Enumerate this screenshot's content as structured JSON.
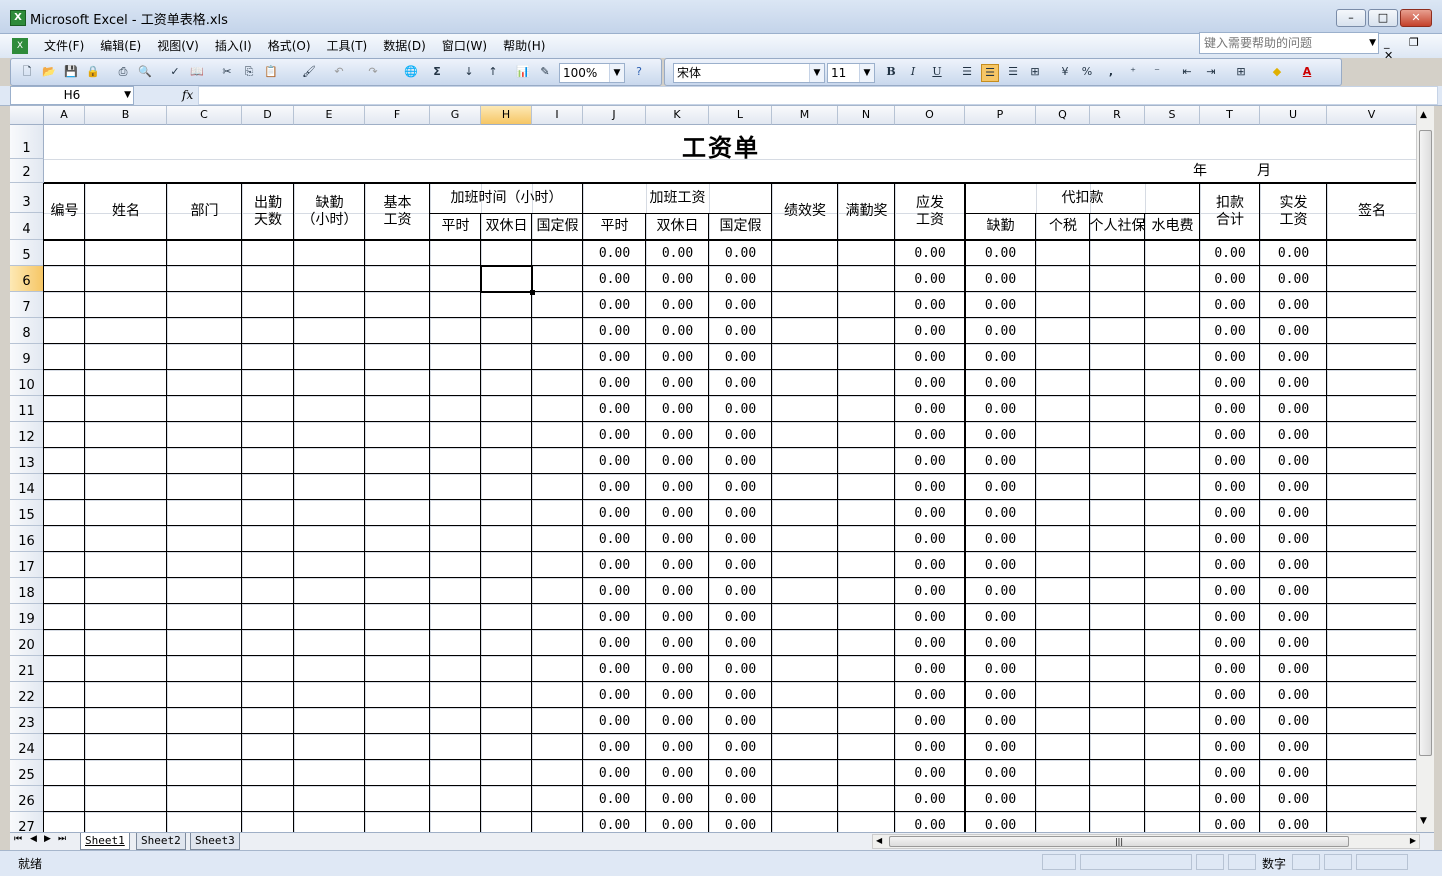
{
  "window": {
    "app_name": "Microsoft Excel",
    "separator": " - ",
    "file_name": "工资单表格.xls"
  },
  "menu": [
    "文件(F)",
    "编辑(E)",
    "视图(V)",
    "插入(I)",
    "格式(O)",
    "工具(T)",
    "数据(D)",
    "窗口(W)",
    "帮助(H)"
  ],
  "help_search": {
    "placeholder": "键入需要帮助的问题"
  },
  "toolbar": {
    "zoom": "100%",
    "font_name": "宋体",
    "font_size": "11",
    "bold": "B",
    "italic": "I",
    "underline": "U",
    "percent": "%",
    "comma": ",",
    "autosum": "Σ",
    "font_color_label": "A"
  },
  "formula_bar": {
    "cell_ref": "H6",
    "fx_label": "fx",
    "formula": ""
  },
  "columns": [
    "A",
    "B",
    "C",
    "D",
    "E",
    "F",
    "G",
    "H",
    "I",
    "J",
    "K",
    "L",
    "M",
    "N",
    "O",
    "P",
    "Q",
    "R",
    "S",
    "T",
    "U",
    "V"
  ],
  "selected_column": "H",
  "rows": [
    "1",
    "2",
    "3",
    "4",
    "5",
    "6",
    "7",
    "8",
    "9",
    "10",
    "11",
    "12",
    "13",
    "14",
    "15",
    "16",
    "17",
    "18",
    "19",
    "20",
    "21",
    "22",
    "23",
    "24",
    "25",
    "26",
    "27"
  ],
  "selected_row": "6",
  "payroll": {
    "title": "工资单",
    "year_label": "年",
    "month_label": "月",
    "headers": {
      "id": "编号",
      "name": "姓名",
      "department": "部门",
      "attendance_days": "出勤\n天数",
      "absence_hours": "缺勤\n（小时）",
      "base_salary": "基本\n工资",
      "overtime_hours": "加班时间（小时）",
      "overtime_pay": "加班工资",
      "weekday": "平时",
      "weekend": "双休日",
      "holiday": "国定假",
      "performance_bonus": "绩效奖",
      "full_attendance_bonus": "满勤奖",
      "gross_pay": "应发\n工资",
      "withholdings": "代扣款",
      "absence_deduction": "缺勤",
      "income_tax": "个税",
      "social_insurance": "个人社保",
      "utilities": "水电费",
      "total_deductions": "扣款\n合计",
      "net_pay": "实发\n工资",
      "signature": "签名"
    },
    "cell_value": "0.00",
    "value_columns": [
      "J",
      "K",
      "L",
      "O",
      "P",
      "T",
      "U"
    ]
  },
  "sheet_tabs": [
    "Sheet1",
    "Sheet2",
    "Sheet3"
  ],
  "active_sheet": "Sheet1",
  "status": {
    "ready": "就绪",
    "num_mode": "数字"
  }
}
